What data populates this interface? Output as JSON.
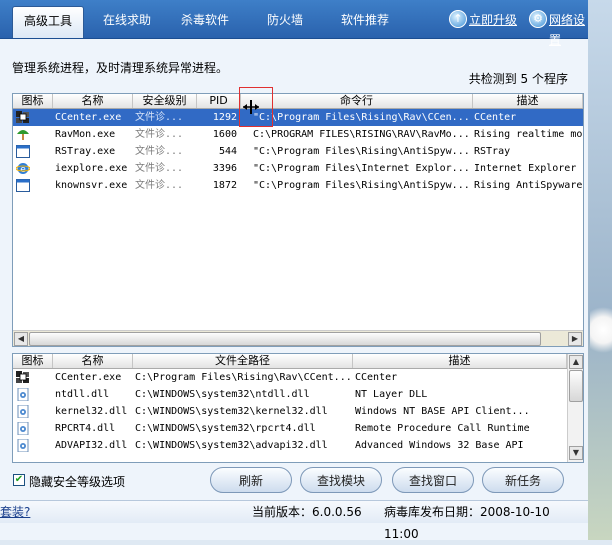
{
  "nav": {
    "tabs": [
      "高级工具",
      "在线求助",
      "杀毒软件",
      "防火墙",
      "软件推荐"
    ],
    "active_tab": "高级工具",
    "upgrade_link": "立即升级",
    "network_settings_link": "网络设置"
  },
  "description": "管理系统进程，及时清理系统异常进程。",
  "process_count": "共检测到 5 个程序",
  "process_table": {
    "columns": [
      "图标",
      "名称",
      "安全级别",
      "PID",
      "命令行",
      "描述"
    ],
    "rows": [
      {
        "name": "CCenter.exe",
        "security": "文件诊...",
        "pid": "1292",
        "cmd": "\"C:\\Program Files\\Rising\\Rav\\CCen...",
        "desc": "CCenter",
        "icon": "rising-app-icon"
      },
      {
        "name": "RavMon.exe",
        "security": "文件诊...",
        "pid": "1600",
        "cmd": "C:\\PROGRAM FILES\\RISING\\RAV\\RavMo...",
        "desc": "Rising realtime mo",
        "icon": "umbrella-icon"
      },
      {
        "name": "RSTray.exe",
        "security": "文件诊...",
        "pid": "544",
        "cmd": "\"C:\\Program Files\\Rising\\AntiSpyw...",
        "desc": "RSTray",
        "icon": "window-icon"
      },
      {
        "name": "iexplore.exe",
        "security": "文件诊...",
        "pid": "3396",
        "cmd": "\"C:\\Program Files\\Internet Explor...",
        "desc": "Internet Explorer",
        "icon": "ie-icon"
      },
      {
        "name": "knownsvr.exe",
        "security": "文件诊...",
        "pid": "1872",
        "cmd": "\"C:\\Program Files\\Rising\\AntiSpyw...",
        "desc": "Rising AntiSpyware",
        "icon": "window-icon"
      }
    ]
  },
  "module_table": {
    "columns": [
      "图标",
      "名称",
      "文件全路径",
      "描述"
    ],
    "rows": [
      {
        "name": "CCenter.exe",
        "path": "C:\\Program Files\\Rising\\Rav\\CCent...",
        "desc": "CCenter",
        "icon": "rising-app-icon"
      },
      {
        "name": "ntdll.dll",
        "path": "C:\\WINDOWS\\system32\\ntdll.dll",
        "desc": "NT Layer DLL",
        "icon": "dll-file-icon"
      },
      {
        "name": "kernel32.dll",
        "path": "C:\\WINDOWS\\system32\\kernel32.dll",
        "desc": "Windows NT BASE API Client...",
        "icon": "dll-file-icon"
      },
      {
        "name": "RPCRT4.dll",
        "path": "C:\\WINDOWS\\system32\\rpcrt4.dll",
        "desc": "Remote Procedure Call Runtime",
        "icon": "dll-file-icon"
      },
      {
        "name": "ADVAPI32.dll",
        "path": "C:\\WINDOWS\\system32\\advapi32.dll",
        "desc": "Advanced Windows 32 Base API",
        "icon": "dll-file-icon"
      }
    ]
  },
  "show_security_level_option": "隐藏安全等级选项",
  "buttons": {
    "refresh": "刷新",
    "find_module": "查找模块",
    "find_window": "查找窗口",
    "new_task": "新任务"
  },
  "status": {
    "left_link": "套装?",
    "version": "当前版本：6.0.0.56",
    "virus_db_date": "病毒库发布日期：2008-10-10 11:00"
  }
}
